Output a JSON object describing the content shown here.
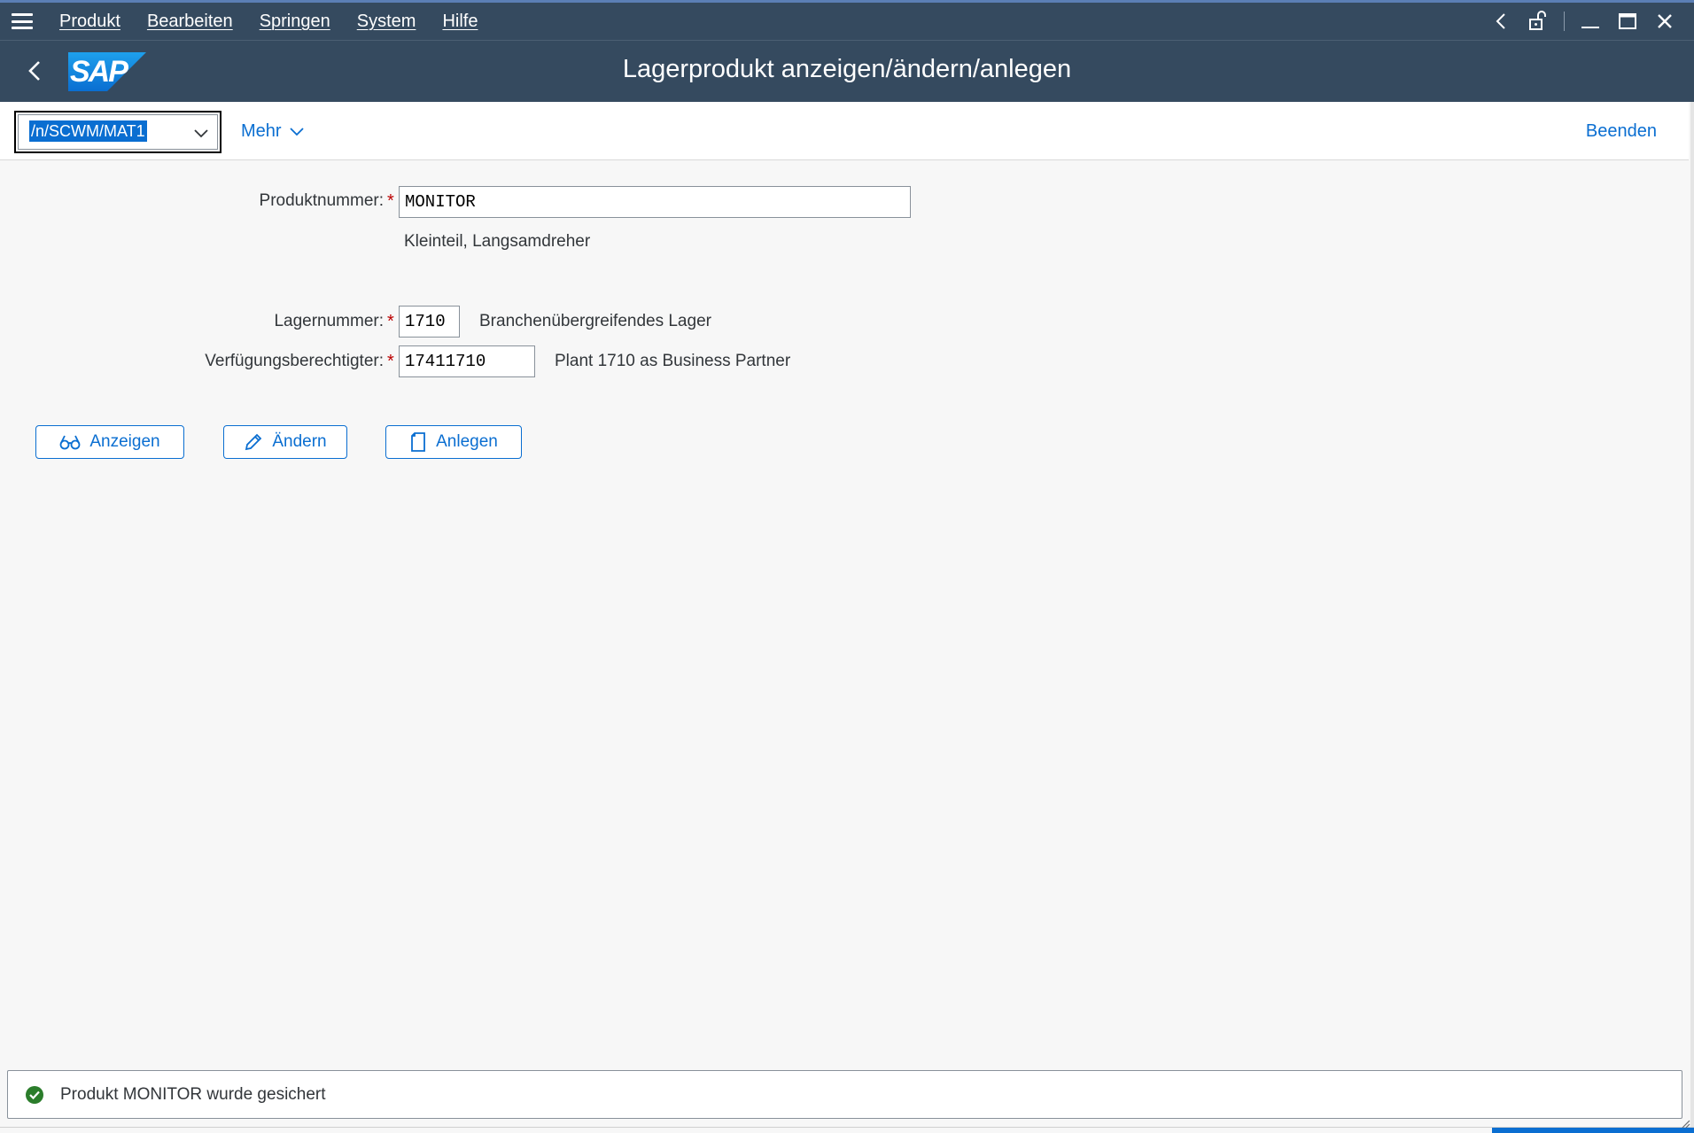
{
  "menubar": {
    "items": [
      "Produkt",
      "Bearbeiten",
      "Springen",
      "System",
      "Hilfe"
    ]
  },
  "shell": {
    "logo_text": "SAP",
    "title": "Lagerprodukt anzeigen/ändern/anlegen"
  },
  "toolbar": {
    "okcode_value": "/n/SCWM/MAT1",
    "more_label": "Mehr",
    "exit_label": "Beenden"
  },
  "form": {
    "product": {
      "label": "Produktnummer:",
      "value": "MONITOR",
      "description": "Kleinteil, Langsamdreher"
    },
    "warehouse": {
      "label": "Lagernummer:",
      "value": "1710",
      "description": "Branchenübergreifendes Lager"
    },
    "party": {
      "label": "Verfügungsberechtigter:",
      "value": "17411710",
      "description": "Plant 1710 as Business Partner"
    }
  },
  "buttons": {
    "display": "Anzeigen",
    "change": "Ändern",
    "create": "Anlegen"
  },
  "status": {
    "message": "Produkt MONITOR wurde gesichert",
    "type": "success",
    "color": "#2b7d2b"
  },
  "colors": {
    "shell": "#354a5f",
    "accent": "#0a6ed1",
    "required": "#bb0000"
  }
}
